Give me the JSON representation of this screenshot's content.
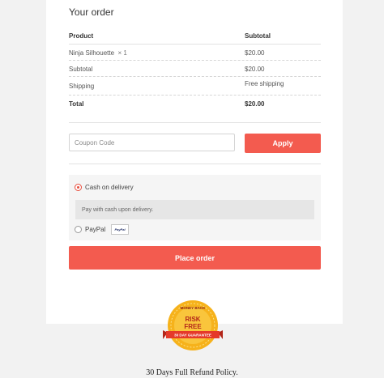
{
  "order": {
    "heading": "Your order",
    "columns": {
      "product": "Product",
      "subtotal": "Subtotal"
    },
    "item": {
      "name": "Ninja Silhouette",
      "qty": "× 1",
      "price": "$20.00"
    },
    "rows": {
      "subtotal_label": "Subtotal",
      "subtotal_value": "$20.00",
      "shipping_label": "Shipping",
      "shipping_value": "Free shipping",
      "total_label": "Total",
      "total_value": "$20.00"
    }
  },
  "coupon": {
    "placeholder": "Coupon Code",
    "apply_label": "Apply"
  },
  "payment": {
    "selected": "cod",
    "cod_label": "Cash on delivery",
    "cod_description": "Pay with cash upon delivery.",
    "paypal_label": "PayPal",
    "paypal_logo": "PayPal"
  },
  "place_order_label": "Place order",
  "badge": {
    "top_text": "MONEY BACK",
    "line1": "RISK",
    "line2": "FREE",
    "ribbon": "30 DAY GUARANTEE",
    "colors": {
      "gold": "#f6b21b",
      "red": "#e53a2a"
    }
  },
  "refund_text": "30 Days Full Refund Policy.",
  "colors": {
    "accent": "#f35b4f",
    "radio_selected": "#e74c3c"
  }
}
